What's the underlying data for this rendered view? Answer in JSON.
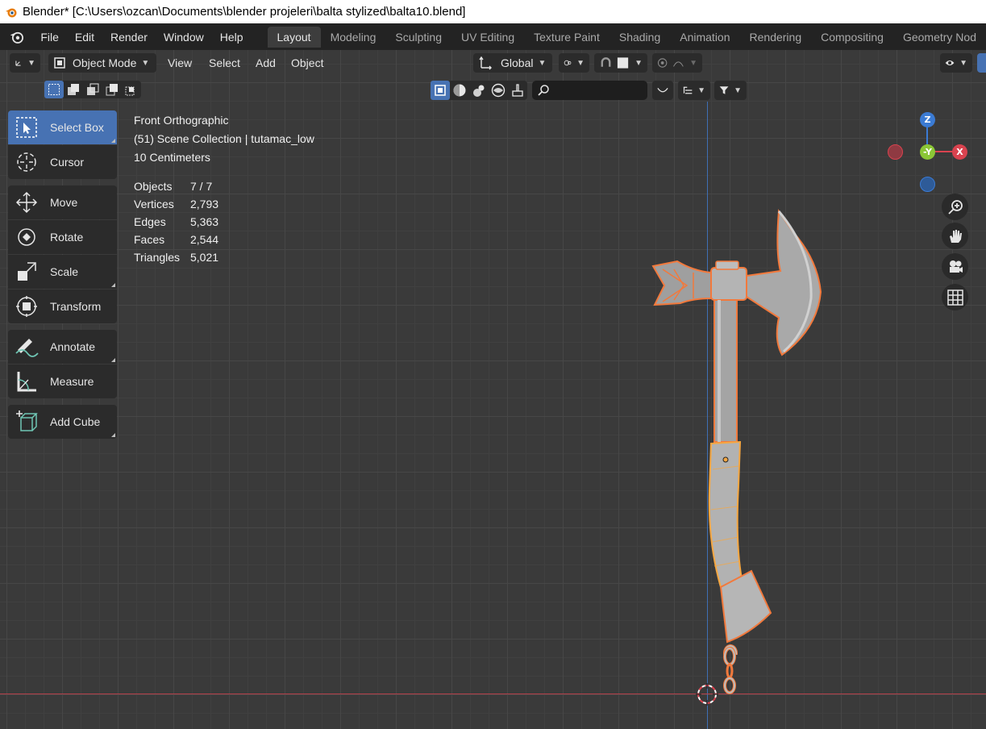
{
  "window": {
    "title": "Blender* [C:\\Users\\ozcan\\Documents\\blender projeleri\\balta stylized\\balta10.blend]"
  },
  "menubar": {
    "items": [
      "File",
      "Edit",
      "Render",
      "Window",
      "Help"
    ],
    "workspaces": [
      "Layout",
      "Modeling",
      "Sculpting",
      "UV Editing",
      "Texture Paint",
      "Shading",
      "Animation",
      "Rendering",
      "Compositing",
      "Geometry Nod"
    ],
    "active_workspace": "Layout"
  },
  "header": {
    "mode": "Object Mode",
    "menus": [
      "View",
      "Select",
      "Add",
      "Object"
    ],
    "orientation": "Global"
  },
  "tools": {
    "select_box": "Select Box",
    "cursor": "Cursor",
    "move": "Move",
    "rotate": "Rotate",
    "scale": "Scale",
    "transform": "Transform",
    "annotate": "Annotate",
    "measure": "Measure",
    "add_cube": "Add Cube"
  },
  "overlay": {
    "view_name": "Front Orthographic",
    "collection": "(51) Scene Collection | tutamac_low",
    "grid_scale": "10 Centimeters",
    "stats": [
      {
        "label": "Objects",
        "value": "7 / 7"
      },
      {
        "label": "Vertices",
        "value": "2,793"
      },
      {
        "label": "Edges",
        "value": "5,363"
      },
      {
        "label": "Faces",
        "value": "2,544"
      },
      {
        "label": "Triangles",
        "value": "5,021"
      }
    ]
  },
  "gizmo": {
    "z": "Z",
    "y": "-Y",
    "x": "X"
  },
  "colors": {
    "accent": "#4772b3",
    "selection_outline": "#f2793c",
    "active_outline": "#f5a742",
    "x_axis": "#d9434f",
    "y_axis": "#8bc736",
    "z_axis": "#3b7bd4"
  }
}
